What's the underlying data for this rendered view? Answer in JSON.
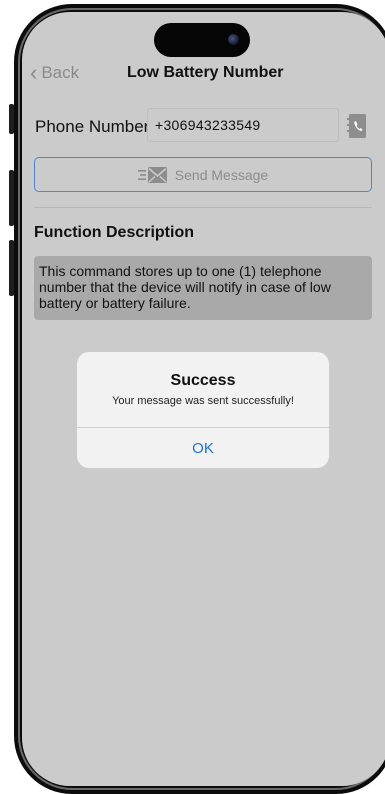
{
  "nav": {
    "back_label": "Back",
    "title": "Low Battery Number"
  },
  "form": {
    "phone_label": "Phone Number",
    "phone_value": "+306943233549",
    "send_label": "Send Message"
  },
  "description": {
    "heading": "Function Description",
    "text": "This command stores up to one (1) telephone number that the device will notify in case of low battery or battery failure."
  },
  "alert": {
    "title": "Success",
    "message": "Your message was sent successfully!",
    "ok_label": "OK"
  },
  "colors": {
    "accent": "#1a73e8",
    "button_border": "#4a86d4",
    "screen_dimmed": "#cbcbcb"
  },
  "icons": {
    "back": "chevron-left-icon",
    "contacts": "contact-book-icon",
    "send": "envelope-icon"
  }
}
